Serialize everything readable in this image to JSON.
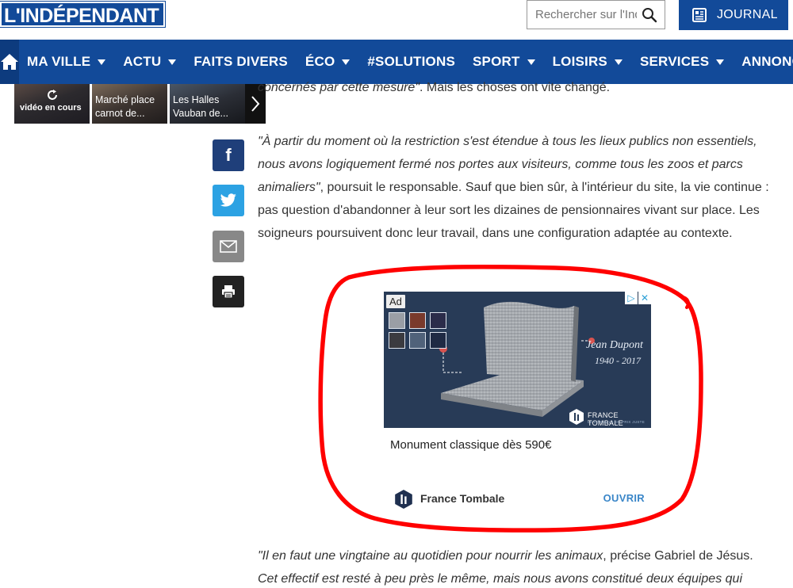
{
  "header": {
    "logo_text": "L'INDÉPENDANT",
    "search_placeholder": "Rechercher sur l'Indépendant",
    "journal_label": "JOURNAL"
  },
  "nav": {
    "items": [
      {
        "label": "MA VILLE",
        "dropdown": true
      },
      {
        "label": "ACTU",
        "dropdown": true
      },
      {
        "label": "FAITS DIVERS",
        "dropdown": false
      },
      {
        "label": "ÉCO",
        "dropdown": true
      },
      {
        "label": "#SOLUTIONS",
        "dropdown": false
      },
      {
        "label": "SPORT",
        "dropdown": true
      },
      {
        "label": "LOISIRS",
        "dropdown": true
      },
      {
        "label": "SERVICES",
        "dropdown": true
      },
      {
        "label": "ANNONCES",
        "dropdown": false
      }
    ]
  },
  "videos": {
    "items": [
      {
        "label": "vidéo en cours"
      },
      {
        "label_line1": "Marché place",
        "label_line2": "carnot de..."
      },
      {
        "label_line1": "Les Halles",
        "label_line2": "Vauban de..."
      }
    ]
  },
  "share": {
    "facebook": "f"
  },
  "article": {
    "p0_italic": "concernés par cette mesure\"",
    "p0_rest": ". Mais les choses ont vite changé.",
    "p1_italic": "\"À partir du moment où la restriction s'est étendue à tous les lieux publics non essentiels, nous avons logiquement fermé nos portes aux visiteurs, comme tous les zoos et parcs animaliers\"",
    "p1_rest": ", poursuit le responsable. Sauf que bien sûr, à l'intérieur du site, la vie continue : pas question d'abandonner à leur sort les dizaines de pensionnaires vivant sur place. Les soigneurs poursuivent donc leur travail, dans une configuration adaptée au contexte.",
    "p2_italic1": "\"Il en faut une vingtaine au quotidien pour nourrir les animaux",
    "p2_rest": ", précise Gabriel de Jésus.",
    "p2_italic2": "Cet effectif est resté à peu près le même, mais nous avons constitué deux équipes qui"
  },
  "ad": {
    "tag": "Ad",
    "engraving_name": "Jean Dupont",
    "engraving_dates": "1940 - 2017",
    "brand": "FRANCE TOMBALE",
    "brand_sub": "LE CONSEILS DU PRIX JUSTE",
    "headline": "Monument classique dès 590€",
    "advertiser": "France Tombale",
    "cta": "OUVRIR",
    "highlight_color": "#ff0000"
  },
  "colors": {
    "brand_blue": "#124a99",
    "facebook": "#1f3f7a",
    "twitter": "#2ca2e3"
  }
}
